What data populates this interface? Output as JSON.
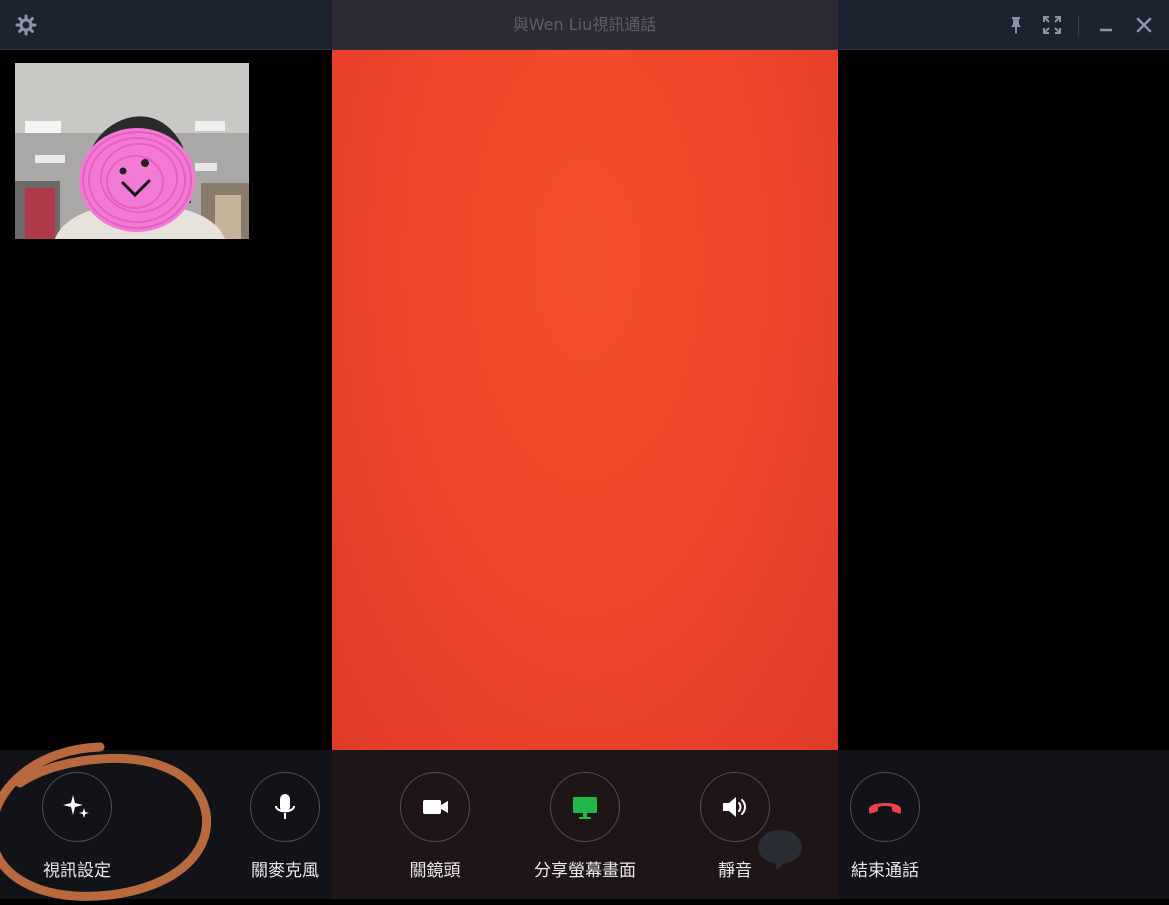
{
  "window": {
    "title": "與Wen Liu視訊通話"
  },
  "controls": [
    {
      "id": "video-settings",
      "label": "視訊設定",
      "icon": "sparkle-icon"
    },
    {
      "id": "mute-mic",
      "label": "關麥克風",
      "icon": "microphone-icon"
    },
    {
      "id": "camera-off",
      "label": "關鏡頭",
      "icon": "video-camera-icon"
    },
    {
      "id": "share-screen",
      "label": "分享螢幕畫面",
      "icon": "monitor-icon"
    },
    {
      "id": "mute-audio",
      "label": "靜音",
      "icon": "speaker-icon"
    },
    {
      "id": "end-call",
      "label": "結束通話",
      "icon": "hang-up-icon"
    }
  ],
  "colors": {
    "titlebar": "#1c2230",
    "remote_video": "#f2472b",
    "share_screen_accent": "#1fb94a",
    "end_call_accent": "#f0414b",
    "annotation_circle": "#b8693d",
    "face_scribble": "#f37ad4"
  }
}
